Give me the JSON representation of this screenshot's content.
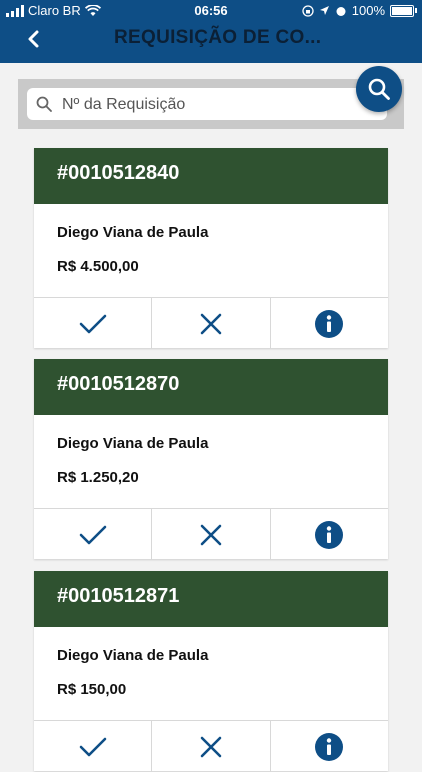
{
  "status_bar": {
    "carrier": "Claro BR",
    "time": "06:56",
    "battery": "100%"
  },
  "header": {
    "title": "REQUISIÇÃO DE CO..."
  },
  "search": {
    "placeholder": "Nº da Requisição",
    "value": ""
  },
  "colors": {
    "header_bg": "#0e4e86",
    "card_header_bg": "#2f5230",
    "action_icon": "#0e4e86"
  },
  "requisitions": [
    {
      "number": "#0010512840",
      "requester": "Diego Viana de Paula",
      "amount": "R$ 4.500,00"
    },
    {
      "number": "#0010512870",
      "requester": "Diego Viana de Paula",
      "amount": "R$ 1.250,20"
    },
    {
      "number": "#0010512871",
      "requester": "Diego Viana de Paula",
      "amount": "R$ 150,00"
    }
  ],
  "action_icons": [
    "check-icon",
    "close-icon",
    "info-icon"
  ]
}
